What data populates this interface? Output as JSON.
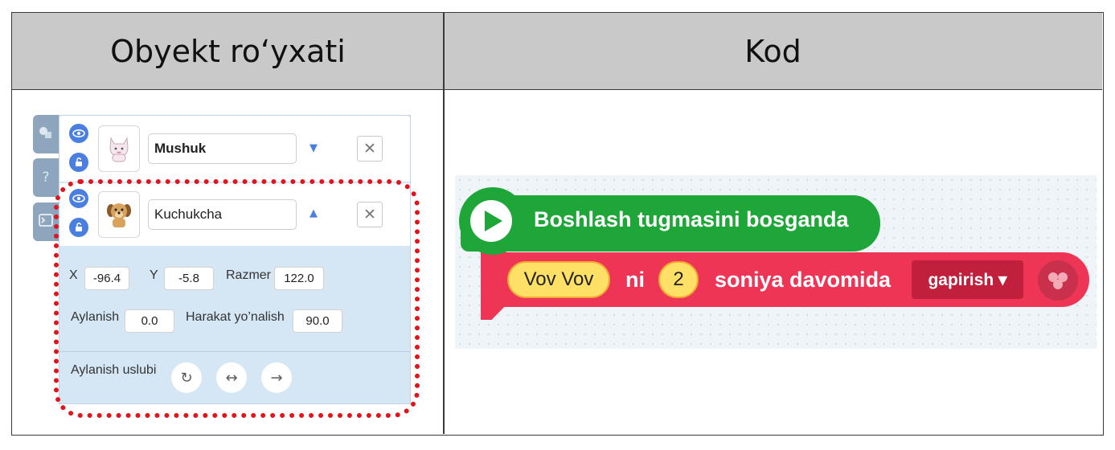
{
  "headers": {
    "object_list": "Obyekt ro‘yxati",
    "code": "Kod"
  },
  "sidebar_tabs": [
    {
      "icon": "shapes-icon"
    },
    {
      "icon": "question-icon",
      "glyph": "?"
    },
    {
      "icon": "terminal-icon",
      "glyph": ">_"
    }
  ],
  "objects": [
    {
      "name": "Mushuk",
      "visible": true,
      "locked": false,
      "expanded": false,
      "caret": "▼"
    },
    {
      "name": "Kuchukcha",
      "visible": true,
      "locked": false,
      "expanded": true,
      "caret": "▲"
    }
  ],
  "properties": {
    "x_label": "X",
    "x_value": "-96.4",
    "y_label": "Y",
    "y_value": "-5.8",
    "size_label": "Razmer",
    "size_value": "122.0",
    "rotation_label": "Aylanish",
    "rotation_value": "0.0",
    "direction_label": "Harakat yo’nalish",
    "direction_value": "90.0",
    "rotation_style_label": "Aylanish uslubi"
  },
  "code_blocks": {
    "hat_label": "Boshlash tugmasini bosganda",
    "say_text": "Vov Vov",
    "say_ni": "ni",
    "say_seconds": "2",
    "say_duration": "soniya davomida",
    "say_mode": "gapirish ▾"
  },
  "colors": {
    "hat": "#1fa638",
    "looks_block": "#ee3555",
    "dropdown": "#c1203c",
    "highlight": "#e0141c",
    "accent": "#4a7fe0"
  }
}
